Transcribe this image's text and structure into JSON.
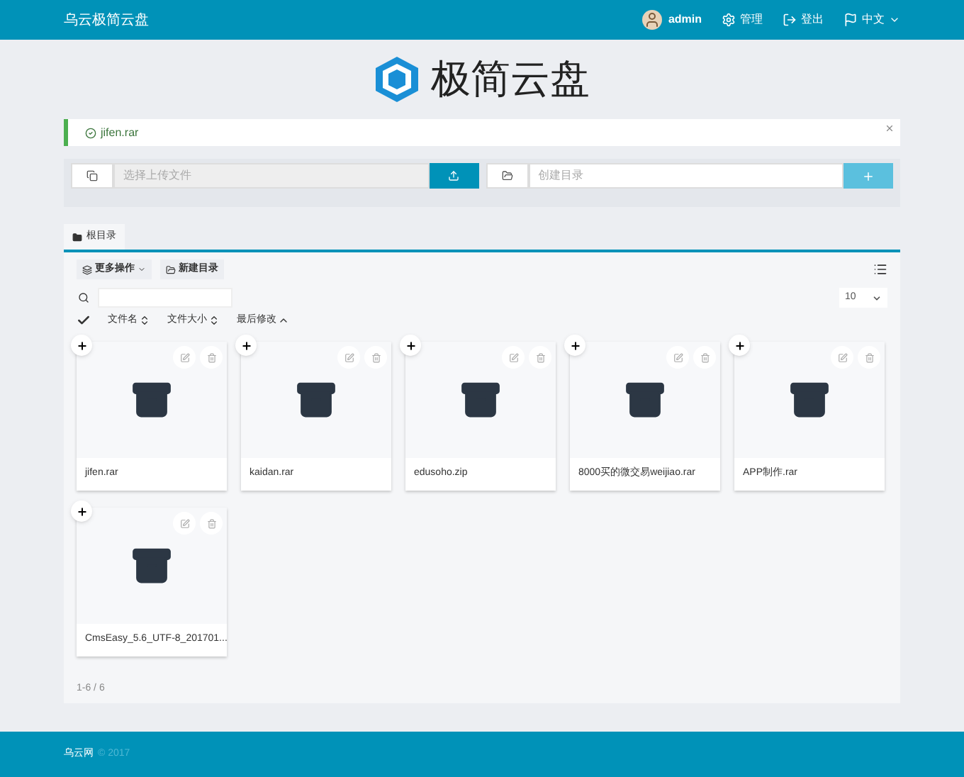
{
  "navbar": {
    "brand": "乌云极简云盘",
    "user": "admin",
    "links": [
      {
        "kind": "admin",
        "label": "管理"
      },
      {
        "kind": "logout",
        "label": "登出"
      },
      {
        "kind": "language",
        "label": "中文"
      }
    ]
  },
  "logo": {
    "title": "极简云盘"
  },
  "alert": {
    "message": "jifen.rar"
  },
  "upload": {
    "placeholder": "选择上传文件"
  },
  "mkdir": {
    "placeholder": "创建目录"
  },
  "breadcrumb": [
    {
      "label": "根目录",
      "selected": true
    }
  ],
  "toolbar": [
    {
      "kind": "dropdown",
      "label": "更多操作"
    },
    {
      "kind": "folder",
      "label": "新建目录"
    }
  ],
  "page_size": "10",
  "columns": [
    {
      "label": "文件名",
      "sorted": false
    },
    {
      "label": "文件大小",
      "sorted": false
    },
    {
      "label": "最后修改",
      "sorted": true
    }
  ],
  "files": [
    {
      "name": "jifen.rar"
    },
    {
      "name": "kaidan.rar"
    },
    {
      "name": "edusoho.zip"
    },
    {
      "name": "8000买的微交易weijiao.rar"
    },
    {
      "name": "APP制作.rar"
    },
    {
      "name": "CmsEasy_5.6_UTF-8_201701..."
    }
  ],
  "pagination": "1-6 / 6",
  "footer": {
    "link": "乌云网",
    "text": "© 2017"
  }
}
